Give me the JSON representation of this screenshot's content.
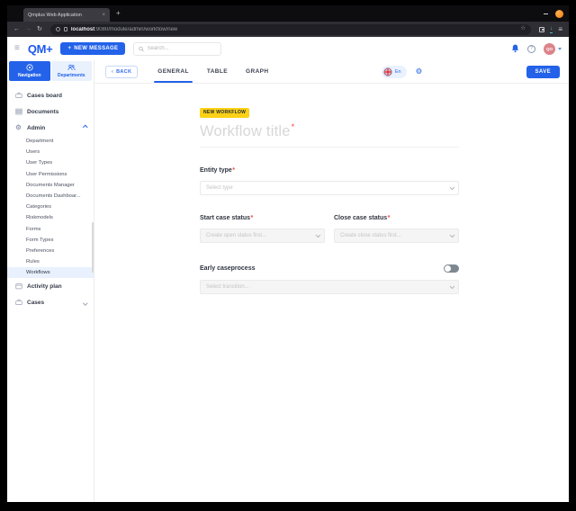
{
  "colors": {
    "accent": "#2362e9",
    "badge_bg": "#fcd116",
    "avatar_bg": "#dd838a",
    "toggle_off_track": "#7e8890",
    "required": "#f5453d"
  },
  "icons": {
    "tab_close": "×",
    "new_tab": "+",
    "back_arrow": "←",
    "forward_arrow": "→",
    "refresh": "↻",
    "star": "☆",
    "download": "↓",
    "menu": "≡",
    "hamburger": "≡",
    "plus": "+",
    "question": "?",
    "gear": "⚙",
    "chevron_left": "‹"
  },
  "browser": {
    "tab_title": "Qmplus Web Application",
    "url_host": "localhost",
    "url_rest": ":9080/module/admin/workflow/new"
  },
  "app": {
    "logo": "QM+",
    "new_message": "NEW MESSAGE",
    "search_placeholder": "Search...",
    "avatar_initials": "QO"
  },
  "sidebar": {
    "tabs": [
      {
        "label": "Navigation"
      },
      {
        "label": "Departments"
      }
    ],
    "items": [
      {
        "label": "Cases board"
      },
      {
        "label": "Documents"
      },
      {
        "label": "Admin"
      },
      {
        "label": "Activity plan"
      },
      {
        "label": "Cases"
      }
    ],
    "admin_children": [
      {
        "label": "Department"
      },
      {
        "label": "Users"
      },
      {
        "label": "User Types"
      },
      {
        "label": "User Permissions"
      },
      {
        "label": "Documents Manager"
      },
      {
        "label": "Documents Dashboar..."
      },
      {
        "label": "Categories"
      },
      {
        "label": "Riskmodels"
      },
      {
        "label": "Forms"
      },
      {
        "label": "Form Types"
      },
      {
        "label": "Preferences"
      },
      {
        "label": "Rules"
      },
      {
        "label": "Workflows"
      }
    ]
  },
  "content": {
    "back": "BACK",
    "tabs": [
      {
        "label": "GENERAL"
      },
      {
        "label": "TABLE"
      },
      {
        "label": "GRAPH"
      }
    ],
    "language": "En",
    "save": "SAVE",
    "badge": "NEW WORKFLOW",
    "title_placeholder": "Workflow title",
    "required": "*",
    "entity_label": "Entity type",
    "entity_placeholder": "Select type",
    "start_label": "Start case status",
    "start_placeholder": "Create open status first...",
    "close_label": "Close case status",
    "close_placeholder": "Create close status first...",
    "early_label": "Early caseprocess",
    "transition_placeholder": "Select transition..."
  }
}
